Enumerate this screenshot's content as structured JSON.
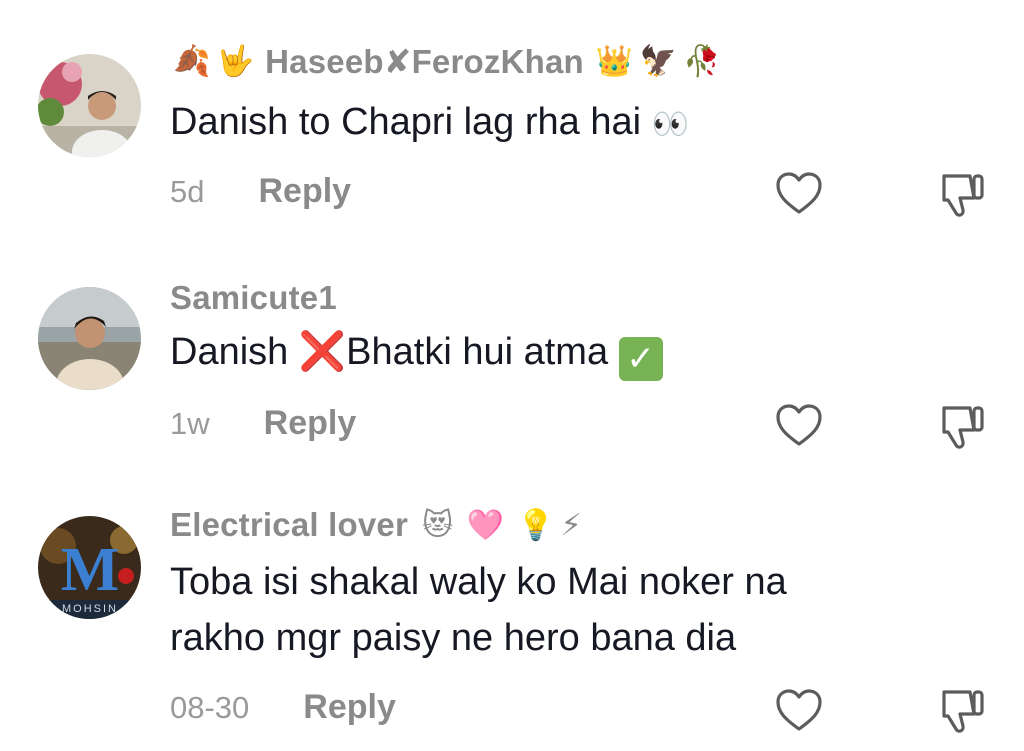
{
  "comments": [
    {
      "username": "Haseeb✘FerozKhan",
      "username_prefix_emojis": [
        "🍂",
        "🤟"
      ],
      "username_suffix_emojis": [
        "👑",
        "🦅",
        "🥀"
      ],
      "text": "Danish to Chapri lag rha hai",
      "text_emoji": "👀",
      "time": "5d",
      "reply_label": "Reply"
    },
    {
      "username": "Samicute1",
      "text_parts": [
        "Danish ",
        "❌",
        "Bhatki hui atma ",
        "✓"
      ],
      "time": "1w",
      "reply_label": "Reply"
    },
    {
      "username": "Electrical lover",
      "username_suffix_emojis": [
        "😻",
        "🩷",
        "💡",
        "⚡"
      ],
      "text_lines": [
        "Toba isi shakal waly ko Mai noker na",
        "rakho mgr paisy ne hero bana dia"
      ],
      "time": "08-30",
      "reply_label": "Reply",
      "avatar_text": "M",
      "avatar_caption": "MOHSIN"
    }
  ],
  "icons": {
    "like": "heart-outline-icon",
    "dislike": "thumbs-down-outline-icon"
  },
  "colors": {
    "username": "#8a8a8a",
    "text": "#161823",
    "meta": "#9a9a9a",
    "icon": "#5c5c5c"
  }
}
